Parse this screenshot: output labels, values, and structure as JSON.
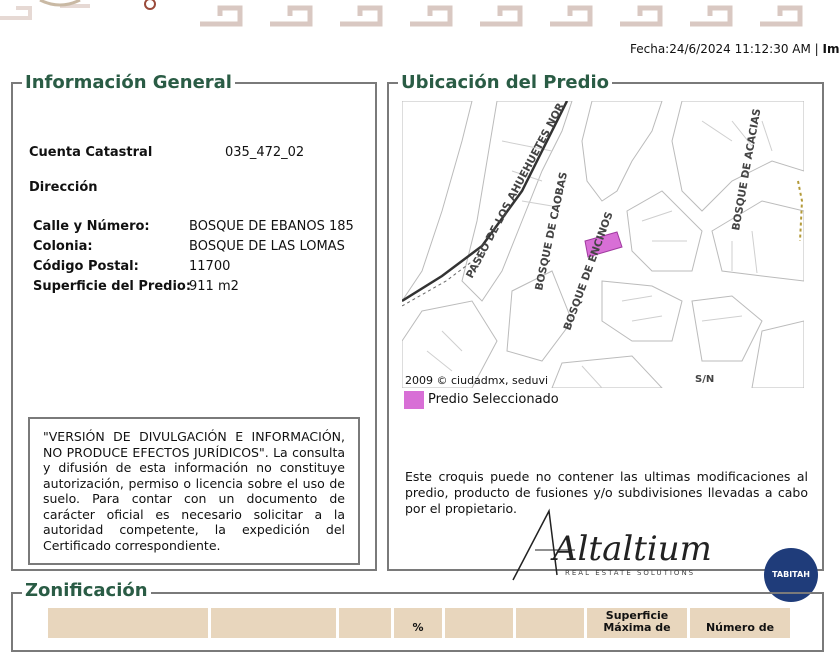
{
  "header": {
    "date_text": "Fecha:24/6/2024 11:12:30 AM",
    "separator": "|",
    "print_link": "Imp"
  },
  "general": {
    "title": "Información General",
    "cuenta_label": "Cuenta Catastral",
    "cuenta_value": "035_472_02",
    "direccion_label": "Dirección",
    "calle_label": "Calle y Número:",
    "calle_value": "BOSQUE DE EBANOS 185",
    "colonia_label": "Colonia:",
    "colonia_value": "BOSQUE DE LAS LOMAS",
    "cp_label": "Código Postal:",
    "cp_value": "11700",
    "superficie_label": "Superficie del Predio:",
    "superficie_value": "911 m2",
    "disclaimer": "\"VERSIÓN DE DIVULGACIÓN E INFORMACIÓN, NO PRODUCE EFECTOS JURÍDICOS\". La consulta y difusión de esta información no constituye autorización, permiso o licencia sobre el uso de suelo. Para contar con un documento de carácter oficial es necesario solicitar a la autoridad competente, la expedición del Certificado correspondiente."
  },
  "ubicacion": {
    "title": "Ubicación del Predio",
    "map_labels": {
      "street1": "PASEO DE LOS AHUEHUETES NOR",
      "street2": "BOSQUE DE CAOBAS",
      "street3": "BOSQUE DE ENCINOS",
      "street4": "BOSQUE DE ACACIAS",
      "sn": "S/N"
    },
    "map_credit": "2009 © ciudadmx, seduvi",
    "legend_label": "Predio Seleccionado",
    "note": "Este croquis puede no contener las ultimas modificaciones al predio, producto de fusiones y/o subdivisiones llevadas a cabo por el propietario."
  },
  "watermark": {
    "brand": "Altaltium",
    "tagline": "REAL ESTATE SOLUTIONS",
    "badge": "TABITAH"
  },
  "zonificacion": {
    "title": "Zonificación",
    "headers": [
      "",
      "",
      "",
      "%",
      "",
      "",
      "Superficie Máxima de",
      "Número de"
    ]
  },
  "colors": {
    "title_green": "#2a5c45",
    "border_gray": "#7a7a7a",
    "predio_magenta": "#d86fd6",
    "table_header": "#e8d6bd",
    "banner_brown": "#9a4a3a"
  }
}
